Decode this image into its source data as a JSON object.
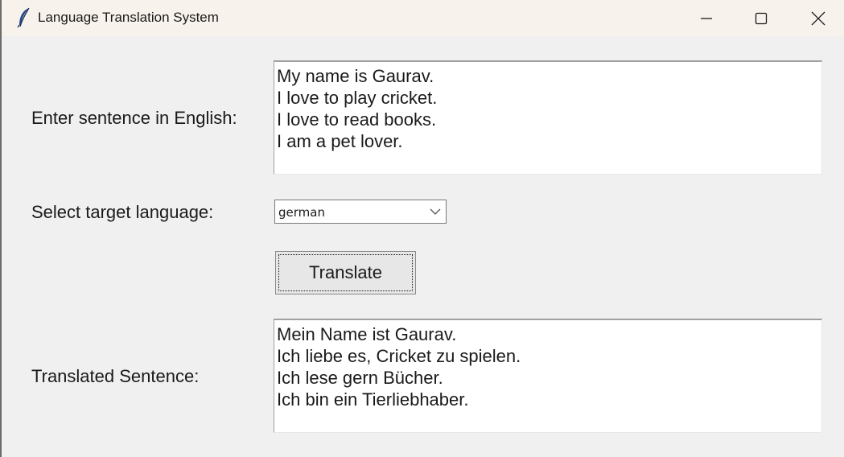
{
  "window": {
    "title": "Language Translation System"
  },
  "form": {
    "input_label": "Enter sentence in English:",
    "input_text": "My name is Gaurav.\nI love to play cricket.\nI love to read books.\nI am a pet lover.",
    "language_label": "Select target language:",
    "language_selected": "german",
    "translate_button": "Translate",
    "output_label": "Translated Sentence:",
    "output_text": "Mein Name ist Gaurav.\nIch liebe es, Cricket zu spielen.\nIch lese gern Bücher.\nIch bin ein Tierliebhaber."
  },
  "icons": {
    "app": "feather-icon",
    "minimize": "minimize-icon",
    "maximize": "maximize-icon",
    "close": "close-icon",
    "dropdown": "chevron-down-icon"
  }
}
